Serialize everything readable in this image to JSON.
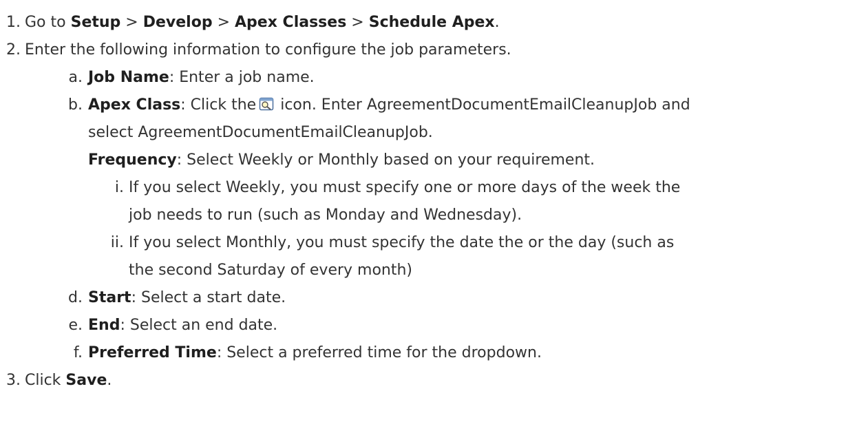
{
  "steps": [
    {
      "marker": "1.",
      "prefix": "Go to ",
      "path": [
        "Setup",
        "Develop",
        "Apex Classes",
        "Schedule Apex"
      ],
      "separator": " > ",
      "suffix": "."
    },
    {
      "marker": "2.",
      "text": "Enter the following information to configure the job parameters.",
      "substeps": [
        {
          "marker": "a.",
          "label": "Job Name",
          "text": ": Enter a job name."
        },
        {
          "marker": "b.",
          "label": "Apex Class",
          "text_before_icon": ": Click the",
          "icon": "lookup-icon",
          "text_after_icon": " icon. Enter AgreementDocumentEmailCleanupJob and",
          "continuation": "select AgreementDocumentEmailCleanupJob."
        },
        {
          "label": "Frequency",
          "text": ": Select Weekly or Monthly based on your requirement.",
          "options": [
            {
              "marker": "i.",
              "line1": "If you select Weekly, you must specify one or more days of the week the",
              "line2": "job needs to run (such as Monday and Wednesday)."
            },
            {
              "marker": "ii.",
              "line1": "If you select Monthly, you must specify the date the or the day (such as",
              "line2": "the second Saturday of every month)"
            }
          ]
        },
        {
          "marker": "d.",
          "label": "Start",
          "text": ": Select a start date."
        },
        {
          "marker": "e.",
          "label": "End",
          "text": ": Select an end date."
        },
        {
          "marker": "f.",
          "label": "Preferred Time",
          "text": ": Select a preferred time for the dropdown."
        }
      ]
    },
    {
      "marker": "3.",
      "prefix": "Click ",
      "label": "Save",
      "suffix": "."
    }
  ]
}
